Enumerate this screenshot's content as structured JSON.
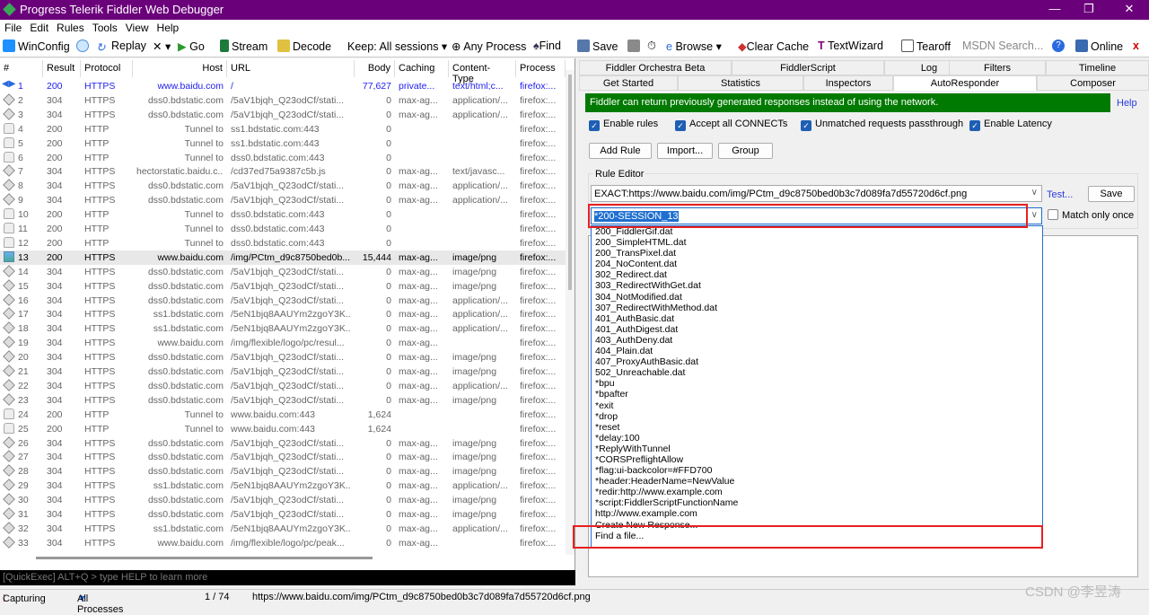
{
  "window": {
    "title": "Progress Telerik Fiddler Web Debugger",
    "minimize": "—",
    "maximize": "❐",
    "close": "✕"
  },
  "menu": [
    "File",
    "Edit",
    "Rules",
    "Tools",
    "View",
    "Help"
  ],
  "toolbar": {
    "winconfig": "WinConfig",
    "replay": "Replay",
    "remove": "✕ ▾",
    "go": "Go",
    "stream": "Stream",
    "decode": "Decode",
    "keep": "Keep: All sessions ▾",
    "any_process": "Any Process",
    "find": "Find",
    "save": "Save",
    "browse": "Browse",
    "clear_cache": "Clear Cache",
    "textwizard": "TextWizard",
    "tearoff": "Tearoff",
    "msdn_placeholder": "MSDN Search...",
    "online": "Online",
    "close": "x"
  },
  "sessions": {
    "columns": [
      "#",
      "Result",
      "Protocol",
      "Host",
      "URL",
      "Body",
      "Caching",
      "Content-Type",
      "Process"
    ],
    "rows": [
      [
        "1",
        "200",
        "HTTPS",
        "www.baidu.com",
        "/",
        "77,627",
        "private...",
        "text/html;c...",
        "firefox:...",
        "arrows"
      ],
      [
        "2",
        "304",
        "HTTPS",
        "dss0.bdstatic.com",
        "/5aV1bjqh_Q23odCf/stati...",
        "0",
        "max-ag...",
        "application/...",
        "firefox:...",
        "cert"
      ],
      [
        "3",
        "304",
        "HTTPS",
        "dss0.bdstatic.com",
        "/5aV1bjqh_Q23odCf/stati...",
        "0",
        "max-ag...",
        "application/...",
        "firefox:...",
        "cert"
      ],
      [
        "4",
        "200",
        "HTTP",
        "Tunnel to",
        "ss1.bdstatic.com:443",
        "0",
        "",
        "",
        "firefox:...",
        "lock"
      ],
      [
        "5",
        "200",
        "HTTP",
        "Tunnel to",
        "ss1.bdstatic.com:443",
        "0",
        "",
        "",
        "firefox:...",
        "lock"
      ],
      [
        "6",
        "200",
        "HTTP",
        "Tunnel to",
        "dss0.bdstatic.com:443",
        "0",
        "",
        "",
        "firefox:...",
        "lock"
      ],
      [
        "7",
        "304",
        "HTTPS",
        "hectorstatic.baidu.c...",
        "/cd37ed75a9387c5b.js",
        "0",
        "max-ag...",
        "text/javasc...",
        "firefox:...",
        "cert"
      ],
      [
        "8",
        "304",
        "HTTPS",
        "dss0.bdstatic.com",
        "/5aV1bjqh_Q23odCf/stati...",
        "0",
        "max-ag...",
        "application/...",
        "firefox:...",
        "cert"
      ],
      [
        "9",
        "304",
        "HTTPS",
        "dss0.bdstatic.com",
        "/5aV1bjqh_Q23odCf/stati...",
        "0",
        "max-ag...",
        "application/...",
        "firefox:...",
        "cert"
      ],
      [
        "10",
        "200",
        "HTTP",
        "Tunnel to",
        "dss0.bdstatic.com:443",
        "0",
        "",
        "",
        "firefox:...",
        "lock"
      ],
      [
        "11",
        "200",
        "HTTP",
        "Tunnel to",
        "dss0.bdstatic.com:443",
        "0",
        "",
        "",
        "firefox:...",
        "lock"
      ],
      [
        "12",
        "200",
        "HTTP",
        "Tunnel to",
        "dss0.bdstatic.com:443",
        "0",
        "",
        "",
        "firefox:...",
        "lock"
      ],
      [
        "13",
        "200",
        "HTTPS",
        "www.baidu.com",
        "/img/PCtm_d9c8750bed0b...",
        "15,444",
        "max-ag...",
        "image/png",
        "firefox:...",
        "img"
      ],
      [
        "14",
        "304",
        "HTTPS",
        "dss0.bdstatic.com",
        "/5aV1bjqh_Q23odCf/stati...",
        "0",
        "max-ag...",
        "image/png",
        "firefox:...",
        "cert"
      ],
      [
        "15",
        "304",
        "HTTPS",
        "dss0.bdstatic.com",
        "/5aV1bjqh_Q23odCf/stati...",
        "0",
        "max-ag...",
        "image/png",
        "firefox:...",
        "cert"
      ],
      [
        "16",
        "304",
        "HTTPS",
        "dss0.bdstatic.com",
        "/5aV1bjqh_Q23odCf/stati...",
        "0",
        "max-ag...",
        "application/...",
        "firefox:...",
        "cert"
      ],
      [
        "17",
        "304",
        "HTTPS",
        "ss1.bdstatic.com",
        "/5eN1bjq8AAUYm2zgoY3K...",
        "0",
        "max-ag...",
        "application/...",
        "firefox:...",
        "cert"
      ],
      [
        "18",
        "304",
        "HTTPS",
        "ss1.bdstatic.com",
        "/5eN1bjq8AAUYm2zgoY3K...",
        "0",
        "max-ag...",
        "application/...",
        "firefox:...",
        "cert"
      ],
      [
        "19",
        "304",
        "HTTPS",
        "www.baidu.com",
        "/img/flexible/logo/pc/resul...",
        "0",
        "max-ag...",
        "",
        "firefox:...",
        "cert"
      ],
      [
        "20",
        "304",
        "HTTPS",
        "dss0.bdstatic.com",
        "/5aV1bjqh_Q23odCf/stati...",
        "0",
        "max-ag...",
        "image/png",
        "firefox:...",
        "cert"
      ],
      [
        "21",
        "304",
        "HTTPS",
        "dss0.bdstatic.com",
        "/5aV1bjqh_Q23odCf/stati...",
        "0",
        "max-ag...",
        "image/png",
        "firefox:...",
        "cert"
      ],
      [
        "22",
        "304",
        "HTTPS",
        "dss0.bdstatic.com",
        "/5aV1bjqh_Q23odCf/stati...",
        "0",
        "max-ag...",
        "application/...",
        "firefox:...",
        "cert"
      ],
      [
        "23",
        "304",
        "HTTPS",
        "dss0.bdstatic.com",
        "/5aV1bjqh_Q23odCf/stati...",
        "0",
        "max-ag...",
        "image/png",
        "firefox:...",
        "cert"
      ],
      [
        "24",
        "200",
        "HTTP",
        "Tunnel to",
        "www.baidu.com:443",
        "1,624",
        "",
        "",
        "firefox:...",
        "lock"
      ],
      [
        "25",
        "200",
        "HTTP",
        "Tunnel to",
        "www.baidu.com:443",
        "1,624",
        "",
        "",
        "firefox:...",
        "lock"
      ],
      [
        "26",
        "304",
        "HTTPS",
        "dss0.bdstatic.com",
        "/5aV1bjqh_Q23odCf/stati...",
        "0",
        "max-ag...",
        "image/png",
        "firefox:...",
        "cert"
      ],
      [
        "27",
        "304",
        "HTTPS",
        "dss0.bdstatic.com",
        "/5aV1bjqh_Q23odCf/stati...",
        "0",
        "max-ag...",
        "image/png",
        "firefox:...",
        "cert"
      ],
      [
        "28",
        "304",
        "HTTPS",
        "dss0.bdstatic.com",
        "/5aV1bjqh_Q23odCf/stati...",
        "0",
        "max-ag...",
        "image/png",
        "firefox:...",
        "cert"
      ],
      [
        "29",
        "304",
        "HTTPS",
        "ss1.bdstatic.com",
        "/5eN1bjq8AAUYm2zgoY3K...",
        "0",
        "max-ag...",
        "application/...",
        "firefox:...",
        "cert"
      ],
      [
        "30",
        "304",
        "HTTPS",
        "dss0.bdstatic.com",
        "/5aV1bjqh_Q23odCf/stati...",
        "0",
        "max-ag...",
        "image/png",
        "firefox:...",
        "cert"
      ],
      [
        "31",
        "304",
        "HTTPS",
        "dss0.bdstatic.com",
        "/5aV1bjqh_Q23odCf/stati...",
        "0",
        "max-ag...",
        "image/png",
        "firefox:...",
        "cert"
      ],
      [
        "32",
        "304",
        "HTTPS",
        "ss1.bdstatic.com",
        "/5eN1bjq8AAUYm2zgoY3K...",
        "0",
        "max-ag...",
        "application/...",
        "firefox:...",
        "cert"
      ],
      [
        "33",
        "304",
        "HTTPS",
        "www.baidu.com",
        "/img/flexible/logo/pc/peak...",
        "0",
        "max-ag...",
        "",
        "firefox:...",
        "cert"
      ]
    ]
  },
  "quickexec": "[QuickExec] ALT+Q > type HELP to learn more",
  "status": {
    "capturing": "Capturing",
    "processes": "All Processes",
    "count": "1 / 74",
    "url": "https://www.baidu.com/img/PCtm_d9c8750bed0b3c7d089fa7d55720d6cf.png"
  },
  "tabs_row1": [
    "Fiddler Orchestra Beta",
    "FiddlerScript",
    "Log",
    "Filters",
    "Timeline"
  ],
  "tabs_row2": [
    "Get Started",
    "Statistics",
    "Inspectors",
    "AutoResponder",
    "Composer"
  ],
  "autoresponder": {
    "banner": "Fiddler can return previously generated responses instead of using the network.",
    "help": "Help",
    "options": [
      {
        "label": "Enable rules",
        "checked": true
      },
      {
        "label": "Accept all CONNECTs",
        "checked": true
      },
      {
        "label": "Unmatched requests passthrough",
        "checked": true
      },
      {
        "label": "Enable Latency",
        "checked": true
      }
    ],
    "buttons": [
      "Add Rule",
      "Import...",
      "Group"
    ],
    "rule_editor_label": "Rule Editor",
    "match_value": "EXACT:https://www.baidu.com/img/PCtm_d9c8750bed0b3c7d089fa7d55720d6cf.png",
    "test": "Test...",
    "save": "Save",
    "action_value": "*200-SESSION_13",
    "match_only_once": "Match only once",
    "dropdown_items": [
      "200_FiddlerGif.dat",
      "200_SimpleHTML.dat",
      "200_TransPixel.dat",
      "204_NoContent.dat",
      "302_Redirect.dat",
      "303_RedirectWithGet.dat",
      "304_NotModified.dat",
      "307_RedirectWithMethod.dat",
      "401_AuthBasic.dat",
      "401_AuthDigest.dat",
      "403_AuthDeny.dat",
      "404_Plain.dat",
      "407_ProxyAuthBasic.dat",
      "502_Unreachable.dat",
      "*bpu",
      "*bpafter",
      "*exit",
      "*drop",
      "*reset",
      "*delay:100",
      "*ReplyWithTunnel",
      "*CORSPreflightAllow",
      "*flag:ui-backcolor=#FFD700",
      "*header:HeaderName=NewValue",
      "*redir:http://www.example.com",
      "*script:FiddlerScriptFunctionName",
      "http://www.example.com",
      "Create New Response...",
      "Find a file..."
    ]
  },
  "watermark": "CSDN @李昱涛",
  "colors": {
    "titlebar": "#6b007b",
    "banner": "#007a00",
    "highlight": "#e82020",
    "selection": "#1e6fd0"
  }
}
